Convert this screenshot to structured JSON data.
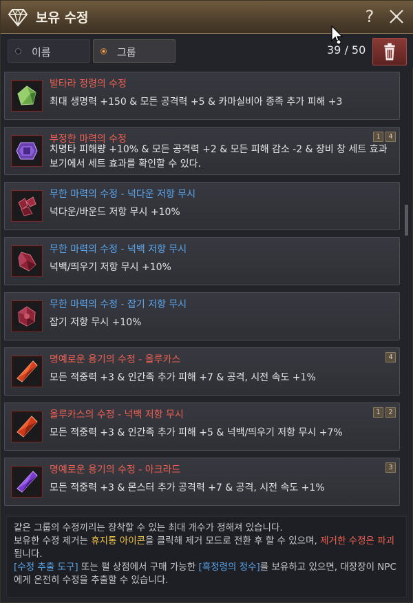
{
  "window": {
    "title": "보유 수정",
    "help_label": "?",
    "icon": "crystal-diamond-icon"
  },
  "toolbar": {
    "sort_name_label": "이름",
    "sort_group_label": "그룹",
    "selected_sort": "그룹",
    "count": "39 / 50"
  },
  "items": [
    {
      "name": "발타라 정령의 수정",
      "name_color": "red",
      "desc": "최대 생명력 +150 & 모든 공격력 +5 & 카마실비아 종족 추가 피해 +3",
      "badges": [],
      "gem": "green"
    },
    {
      "name": "부정한 마력의 수정",
      "name_color": "red",
      "desc": "치명타 피해량 +10% & 모든 공격력 +2 & 모든 피해 감소 -2 & 장비 창 세트 효과 보기에서 세트 효과를 확인할 수 있다.",
      "badges": [
        "1",
        "4"
      ],
      "gem": "purple"
    },
    {
      "name": "무한 마력의 수정 - 넉다운 저항 무시",
      "name_color": "blue",
      "desc": "넉다운/바운드 저항 무시 +10%",
      "badges": [],
      "gem": "crimson"
    },
    {
      "name": "무한 마력의 수정 - 넉백 저항 무시",
      "name_color": "blue",
      "desc": "넉백/띄우기 저항 무시 +10%",
      "badges": [],
      "gem": "crimson"
    },
    {
      "name": "무한 마력의 수정 - 잡기 저항 무시",
      "name_color": "blue",
      "desc": "잡기 저항 무시 +10%",
      "badges": [],
      "gem": "crimson"
    },
    {
      "name": "명예로운 용기의 수정 - 올루카스",
      "name_color": "red",
      "desc": "모든 적중력 +3 & 인간족 추가 피해 +7 & 공격, 시전 속도 +1%",
      "badges": [
        "4"
      ],
      "gem": "orange"
    },
    {
      "name": "올루카스의 수정 - 넉백 저항 무시",
      "name_color": "red",
      "desc": "모든 적중력 +3 & 인간족 추가 피해 +5 & 넉백/띄우기 저항 무시 +7%",
      "badges": [
        "1",
        "2"
      ],
      "gem": "orange"
    },
    {
      "name": "명예로운 용기의 수정 - 아크라드",
      "name_color": "red",
      "desc": "모든 적중력 +3 & 몬스터 추가 공격력 +7 & 공격, 시전 속도 +1%",
      "badges": [
        "3"
      ],
      "gem": "violet"
    }
  ],
  "info": {
    "line1": "같은 그룹의 수정끼리는 장착할 수 있는 최대 개수가 정해져 있습니다.",
    "line2_a": "보유한 수정 제거는 ",
    "line2_hl": "휴지통 아이콘",
    "line2_b": "을 클릭해 제거 모드로 전환 후 할 수 있으며, ",
    "line2_red": "제거한 수정은 파괴",
    "line2_c": "됩니다.",
    "line3_hl1": "[수정 추출 도구]",
    "line3_a": " 또는 펄 상점에서 구매 가능한 ",
    "line3_hl2": "[흑정령의 정수]",
    "line3_b": "를 보유하고 있으면, 대장장이 NPC에게 온전히 수정을 추출할 수 있습니다."
  },
  "colors": {
    "red_text": "#f06052",
    "blue_text": "#5aa6ec",
    "yellow_text": "#f2c84a"
  }
}
